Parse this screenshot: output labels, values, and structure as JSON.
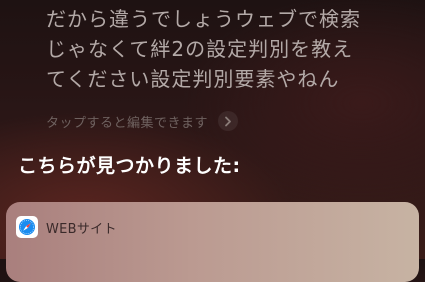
{
  "siri": {
    "request_text": "だから違うでしょうウェブで検索\nじゃなくて絆2の設定判別を教え\nてください設定判別要素やねん",
    "tap_hint": "タップすると編集できます",
    "response_title": "こちらが見つかりました:"
  },
  "result_card": {
    "label": "WEBサイト",
    "icon": "safari-compass-icon"
  },
  "icons": {
    "tap_hint_icon": "chevron-right-icon"
  },
  "colors": {
    "request_text": "#b3a9a7",
    "hint_text": "#6f6260",
    "title_text": "#ffffff",
    "safari_blue": "#1a8cf0"
  }
}
